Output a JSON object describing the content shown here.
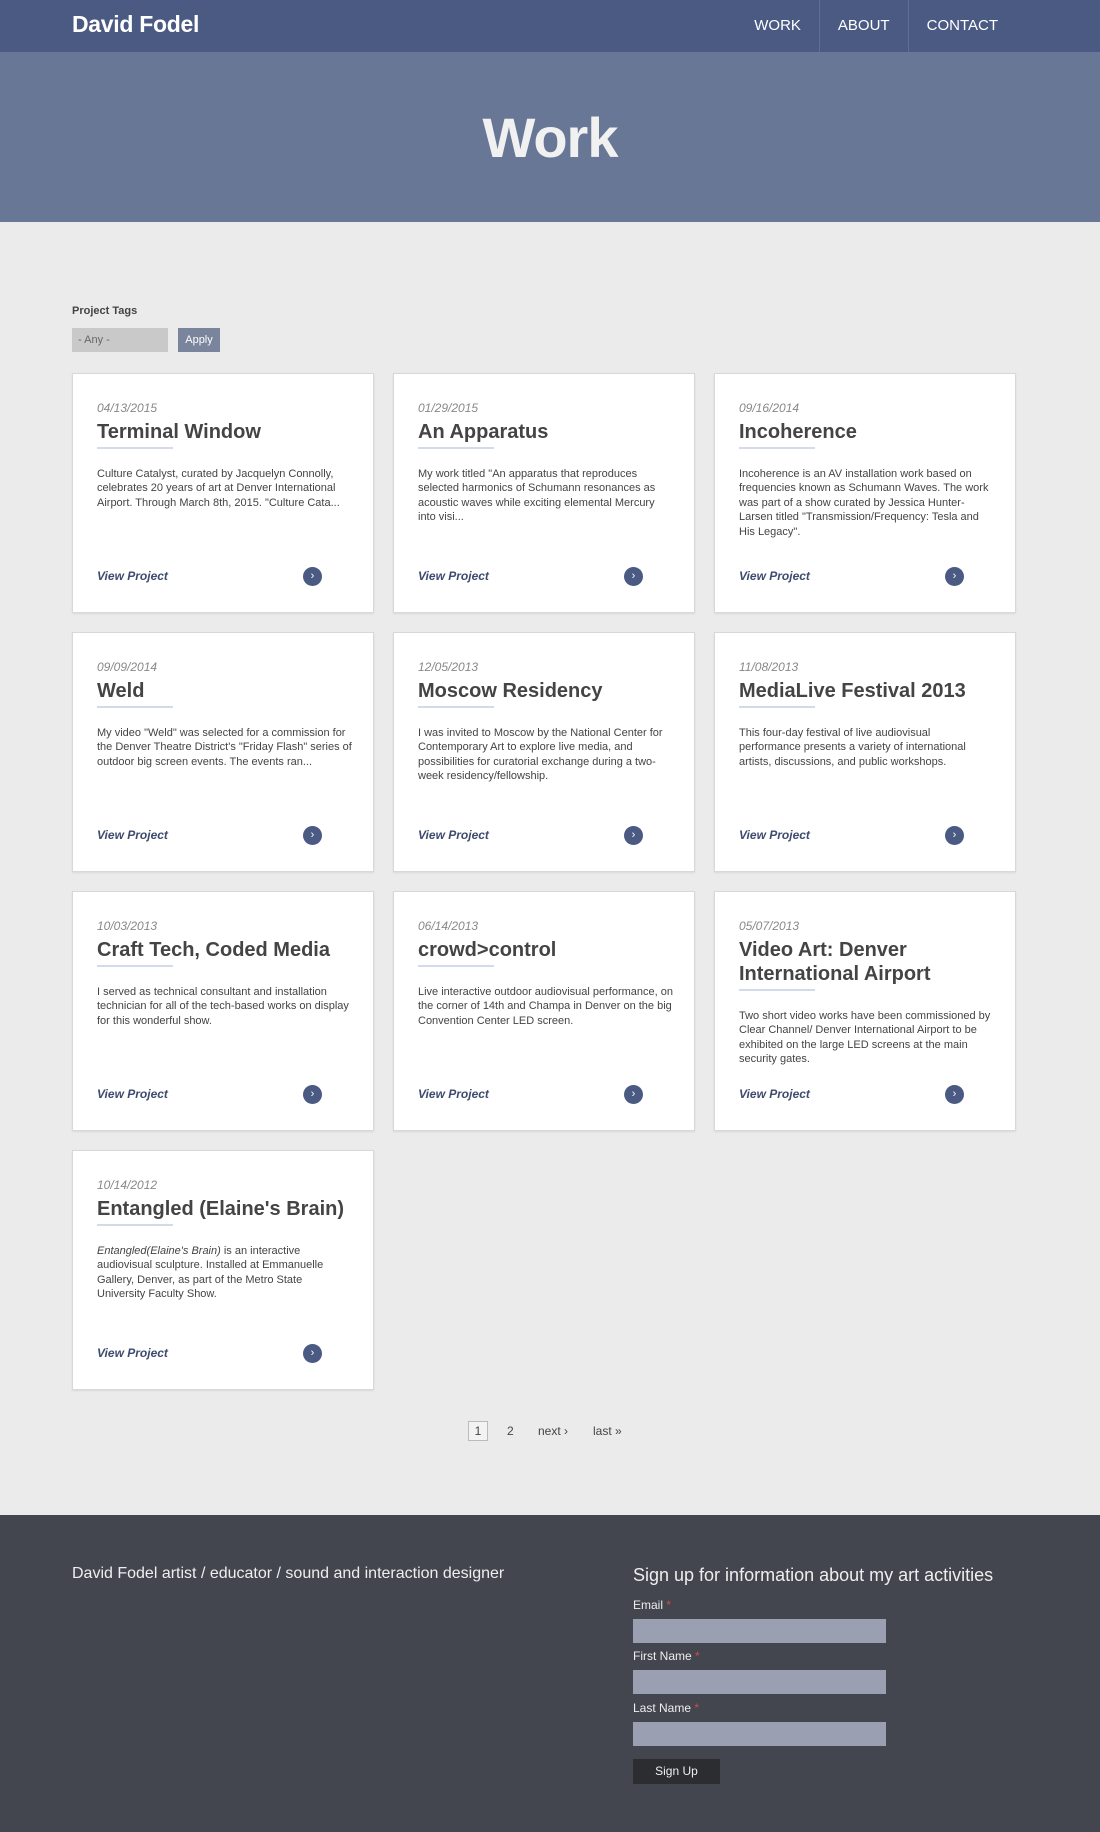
{
  "header": {
    "brand": "David Fodel",
    "nav": [
      "WORK",
      "ABOUT",
      "CONTACT"
    ]
  },
  "hero": {
    "title": "Work"
  },
  "filter": {
    "label": "Project Tags",
    "select_value": "- Any -",
    "apply_label": "Apply"
  },
  "cards": [
    {
      "date": "04/13/2015",
      "title": "Terminal Window",
      "excerpt": "Culture Catalyst, curated by Jacquelyn Connolly, celebrates 20 years of art at Denver International Airport. Through March 8th, 2015. \"Culture Cata...",
      "view": "View Project",
      "arrow": "›"
    },
    {
      "date": "01/29/2015",
      "title": "An Apparatus",
      "excerpt": "My work titled \"An apparatus that reproduces selected harmonics of Schumann resonances as acoustic waves while exciting elemental Mercury into visi...",
      "view": "View Project",
      "arrow": "›"
    },
    {
      "date": "09/16/2014",
      "title": "Incoherence",
      "excerpt": "Incoherence is an AV installation work based on frequencies known as Schumann Waves. The work was part of a show curated by Jessica Hunter-Larsen titled \"Transmission/Frequency: Tesla and His Legacy\".",
      "view": "View Project",
      "arrow": "›"
    },
    {
      "date": "09/09/2014",
      "title": "Weld",
      "excerpt": "My video \"Weld\" was selected for a commission for the Denver Theatre District's \"Friday Flash\" series of outdoor big screen events. The events ran...",
      "view": "View Project",
      "arrow": "›"
    },
    {
      "date": "12/05/2013",
      "title": "Moscow Residency",
      "excerpt": "I was invited to Moscow by the National Center for Contemporary Art to explore live media, and possibilities for curatorial exchange during a two-week residency/fellowship.",
      "view": "View Project",
      "arrow": "›"
    },
    {
      "date": "11/08/2013",
      "title": "MediaLive Festival 2013",
      "excerpt": "This four-day festival of live audiovisual performance presents a variety of international artists, discussions, and  public workshops.",
      "view": "View Project",
      "arrow": "›"
    },
    {
      "date": "10/03/2013",
      "title": "Craft Tech, Coded Media",
      "excerpt": "I served as technical consultant and installation technician for all of the tech-based works on display for this wonderful show.",
      "view": "View Project",
      "arrow": "›"
    },
    {
      "date": "06/14/2013",
      "title": "crowd>control",
      "excerpt": "Live interactive outdoor audiovisual performance, on the corner of 14th and Champa in Denver on the big Convention Center LED screen.",
      "view": "View Project",
      "arrow": "›"
    },
    {
      "date": "05/07/2013",
      "title": "Video Art: Denver International Airport",
      "excerpt": "Two short video works have been commissioned by Clear Channel/ Denver International Airport to be exhibited on the large LED screens at the main security gates.",
      "view": "View Project",
      "arrow": "›"
    },
    {
      "date": "10/14/2012",
      "title": "Entangled (Elaine's Brain)",
      "excerpt_em": "Entangled(Elaine's Brain)",
      "excerpt": " is an interactive audiovisual sculpture. Installed at Emmanuelle Gallery, Denver, as part of the Metro State University Faculty Show.",
      "view": "View Project",
      "arrow": "›"
    }
  ],
  "pager": {
    "current": "1",
    "page2": "2",
    "next": "next ›",
    "last": "last »"
  },
  "footer": {
    "tagline": "David Fodel artist / educator / sound and interaction designer",
    "signup_title": "Sign up for information about my art activities",
    "email_label": "Email",
    "first_name_label": "First Name",
    "last_name_label": "Last Name",
    "required_mark": "*",
    "signup_button": "Sign Up"
  },
  "colors": {
    "header_bg": "#4b5a83",
    "hero_bg": "#687795",
    "footer_bg": "#43464f",
    "accent": "#4b5a83"
  }
}
